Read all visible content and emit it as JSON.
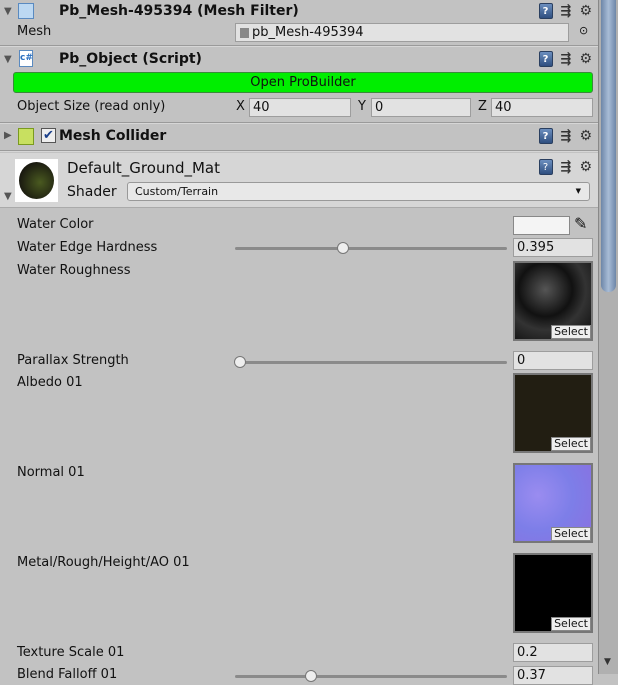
{
  "mesh_filter": {
    "title": "Pb_Mesh-495394 (Mesh Filter)",
    "mesh_label": "Mesh",
    "mesh_value": "pb_Mesh-495394"
  },
  "pb_object": {
    "title": "Pb_Object (Script)",
    "button": "Open ProBuilder",
    "size_label": "Object Size (read only)",
    "x_label": "X",
    "x": "40",
    "y_label": "Y",
    "y": "0",
    "z_label": "Z",
    "z": "40"
  },
  "mesh_collider": {
    "title": "Mesh Collider",
    "enabled": true
  },
  "material": {
    "name": "Default_Ground_Mat",
    "shader_label": "Shader",
    "shader": "Custom/Terrain"
  },
  "props": {
    "water_color": "Water Color",
    "edge_hardness": "Water Edge Hardness",
    "edge_hardness_value": "0.395",
    "edge_hardness_fraction": 0.395,
    "roughness": "Water Roughness",
    "parallax": "Parallax Strength",
    "parallax_value": "0",
    "parallax_fraction": 0,
    "albedo": "Albedo 01",
    "normal": "Normal 01",
    "metal": "Metal/Rough/Height/AO 01",
    "tex_scale": "Texture Scale 01",
    "tex_scale_value": "0.2",
    "blend": "Blend Falloff 01",
    "blend_value": "0.37",
    "select": "Select"
  },
  "colors": {
    "button": "#00ee00",
    "water_color": "#f4f4f4"
  }
}
